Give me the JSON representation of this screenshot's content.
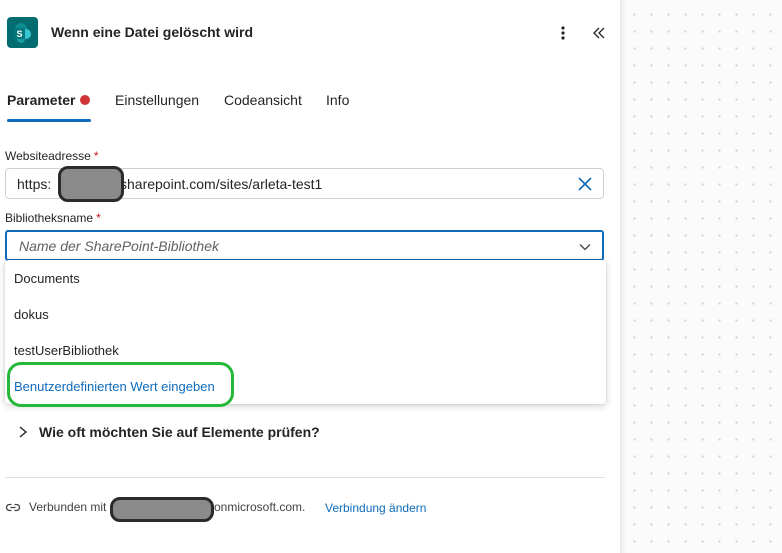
{
  "header": {
    "title": "Wenn eine Datei gelöscht wird",
    "app_icon_letter": "S"
  },
  "tabs": [
    {
      "label": "Parameter",
      "active": true,
      "has_error": true
    },
    {
      "label": "Einstellungen"
    },
    {
      "label": "Codeansicht"
    },
    {
      "label": "Info"
    }
  ],
  "fields": {
    "site": {
      "label": "Websiteadresse",
      "required_mark": "*",
      "value_prefix": "https:",
      "value_suffix": "sharepoint.com/sites/arleta-test1"
    },
    "library": {
      "label": "Bibliotheksname",
      "required_mark": "*",
      "placeholder": "Name der SharePoint-Bibliothek"
    }
  },
  "dropdown": {
    "options": [
      "Documents",
      "dokus",
      "testUserBibliothek"
    ],
    "custom_option": "Benutzerdefinierten Wert eingeben"
  },
  "section": {
    "label": "Wie oft möchten Sie auf Elemente prüfen?"
  },
  "footer": {
    "connected_prefix": "Verbunden mit",
    "connected_suffix": "onmicrosoft.com.",
    "change_link": "Verbindung ändern"
  },
  "colors": {
    "accent": "#0f6cbd",
    "error": "#d13438",
    "highlight": "#25b83a",
    "sharepoint": "#036c70"
  }
}
